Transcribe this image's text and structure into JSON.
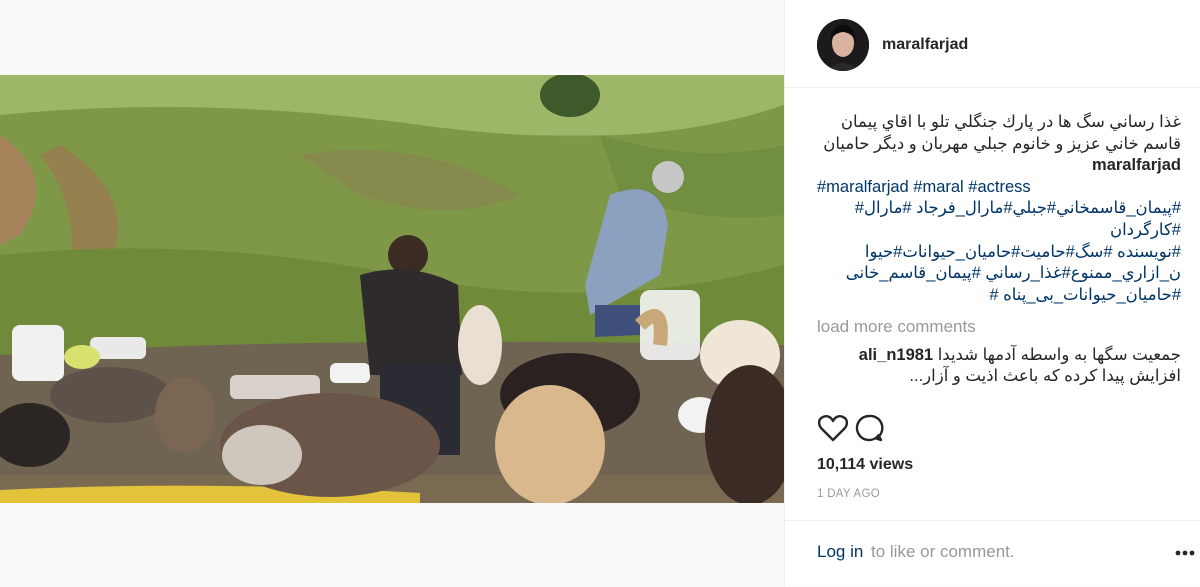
{
  "post": {
    "photo_alt": "photo of people feeding dogs in a park",
    "username": "maralfarjad",
    "caption_text": "غذا رساني سگ ها در پارك جنگلي تلو با اقاي پيمان قاسم خاني عزيز و خانوم جبلي مهربان و ديگر حاميان",
    "caption_tags_line1": "#maralfarjad #maral #actress",
    "caption_tags_line2": "#پیمان_قاسمخاني#جبلي#مارال_فرجاد #مارال#",
    "caption_tags_line3": "#کارگردان",
    "caption_tags_line4": "#نويسنده #سگ#حاميت#حاميان_حيوانات#حيوا",
    "caption_tags_line5": "ن_ازاري_ممنوع#غذا_رساني  #پيمان_قاسم_خانی",
    "caption_tags_line6": "#حاميان_حيوانات_بی_پناه #",
    "load_more": "load more comments",
    "comment_author": "ali_n1981",
    "comment_text": "جمعیت سگها به واسطه آدمها شدیدا",
    "comment_text_cont": "افزایش پیدا کرده که باعث اذیت و آزار...",
    "views": "10,114 views",
    "time": "1 DAY AGO"
  },
  "footer": {
    "login": "Log in",
    "login_rest": "to like or comment."
  },
  "icons": {
    "like": "heart-icon",
    "comment": "comment-icon",
    "more": "more-options-icon"
  },
  "colors": {
    "link": "#003569",
    "muted": "#999999",
    "text": "#262626"
  }
}
